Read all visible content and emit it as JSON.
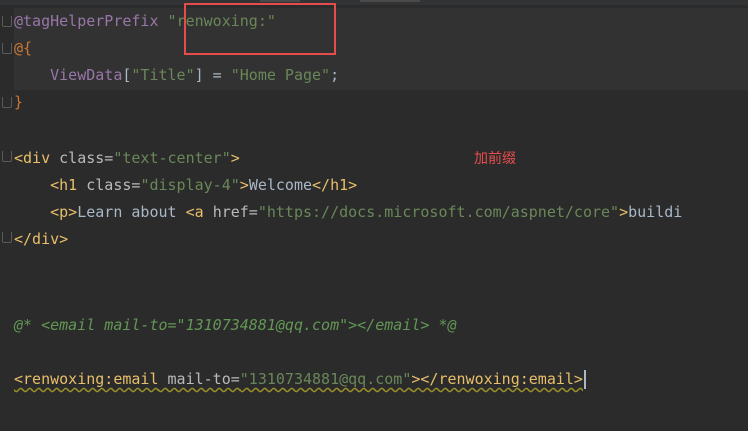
{
  "annotation": {
    "text": "加前缀",
    "color": "#e74c4c"
  },
  "code": {
    "l1": {
      "directive": "@tagHelperPrefix",
      "value": "\"renwoxing:\""
    },
    "l2": "@{",
    "l3": {
      "name": "ViewData",
      "bracket_open": "[",
      "key": "\"Title\"",
      "bracket_close": "]",
      "assign": " = ",
      "value": "\"Home Page\"",
      "semi": ";"
    },
    "l4": "}",
    "l5": {
      "open": "<div",
      "attr": "class=",
      "value": "\"text-center\"",
      "close": ">"
    },
    "l6": {
      "open": "<h1",
      "attr": "class=",
      "value": "\"display-4\"",
      "gt": ">",
      "text": "Welcome",
      "end": "</h1>"
    },
    "l7": {
      "open": "<p>",
      "text": "Learn about ",
      "a_open": "<a",
      "attr": "href=",
      "value": "\"https://docs.microsoft.com/aspnet/core\"",
      "gt": ">",
      "text2": "buildi"
    },
    "l8": "</div>",
    "l9": "@* <email mail-to=\"1310734881@qq.com\"></email> *@",
    "l10": {
      "open": "<renwoxing:email",
      "attr": "mail-to=",
      "value": "\"1310734881@qq.com\"",
      "gt": ">",
      "end": "</renwoxing:email>"
    }
  }
}
